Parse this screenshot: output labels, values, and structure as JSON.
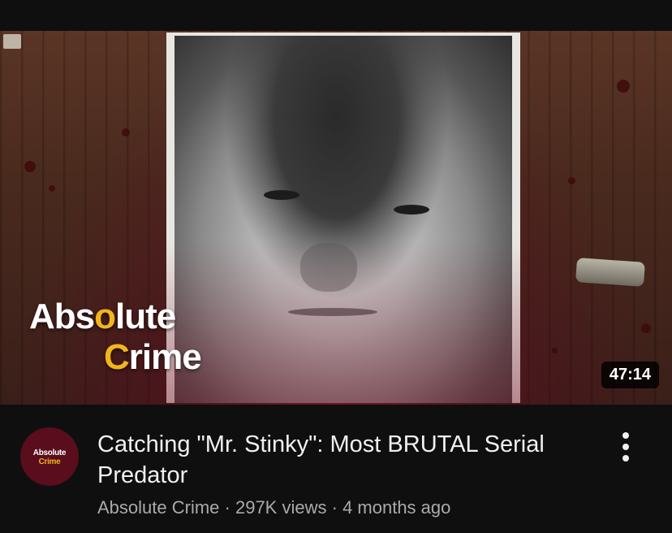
{
  "video": {
    "thumbnail": {
      "brand_line1_pre": "Abs",
      "brand_line1_accent": "o",
      "brand_line1_post": "lute",
      "brand_line2_accent": "C",
      "brand_line2_post": "rime",
      "duration": "47:14"
    },
    "title": "Catching \"Mr. Stinky\": Most BRUTAL Serial Predator",
    "channel": {
      "name": "Absolute Crime",
      "avatar_line1": "Absolute",
      "avatar_line2": "Crime"
    },
    "separator": "·",
    "views": "297K views",
    "age": "4 months ago"
  },
  "colors": {
    "background": "#0f0f0f",
    "title": "#f1f1f1",
    "meta": "#aaaaaa",
    "brand_accent": "#f2b51a",
    "avatar_bg": "#5a0d1c"
  },
  "icons": {
    "more": "more-vert-icon"
  }
}
